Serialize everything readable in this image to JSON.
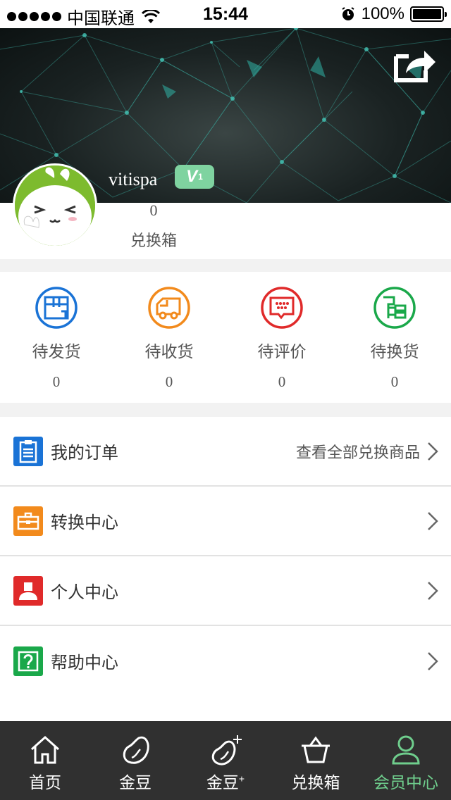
{
  "status_bar": {
    "carrier": "中国联通",
    "time": "15:44",
    "battery": "100%"
  },
  "profile": {
    "username": "vitispa",
    "vip_level": "V",
    "vip_sub": "1",
    "box_count": "0",
    "box_label": "兑换箱"
  },
  "order_status": [
    {
      "label": "待发货",
      "count": "0",
      "icon": "package-icon",
      "color": "#1a73d6"
    },
    {
      "label": "待收货",
      "count": "0",
      "icon": "truck-icon",
      "color": "#f28a1c"
    },
    {
      "label": "待评价",
      "count": "0",
      "icon": "comment-icon",
      "color": "#e02a2a"
    },
    {
      "label": "待换货",
      "count": "0",
      "icon": "exchange-icon",
      "color": "#1aa84a"
    }
  ],
  "menu": [
    {
      "label": "我的订单",
      "extra": "查看全部兑换商品",
      "icon": "clipboard-icon",
      "color": "#1a73d6"
    },
    {
      "label": "转换中心",
      "extra": "",
      "icon": "briefcase-icon",
      "color": "#f28a1c"
    },
    {
      "label": "个人中心",
      "extra": "",
      "icon": "person-icon",
      "color": "#e02a2a"
    },
    {
      "label": "帮助中心",
      "extra": "",
      "icon": "help-icon",
      "color": "#1aa84a"
    }
  ],
  "tabbar": [
    {
      "label": "首页",
      "icon": "home-icon"
    },
    {
      "label": "金豆",
      "icon": "bean-icon"
    },
    {
      "label": "金豆",
      "label_sup": "+",
      "icon": "bean-plus-icon"
    },
    {
      "label": "兑换箱",
      "icon": "basket-icon"
    },
    {
      "label": "会员中心",
      "icon": "user-icon",
      "active": true
    }
  ],
  "colors": {
    "accent_green": "#6fce8d",
    "tabbar_bg": "#303030"
  }
}
